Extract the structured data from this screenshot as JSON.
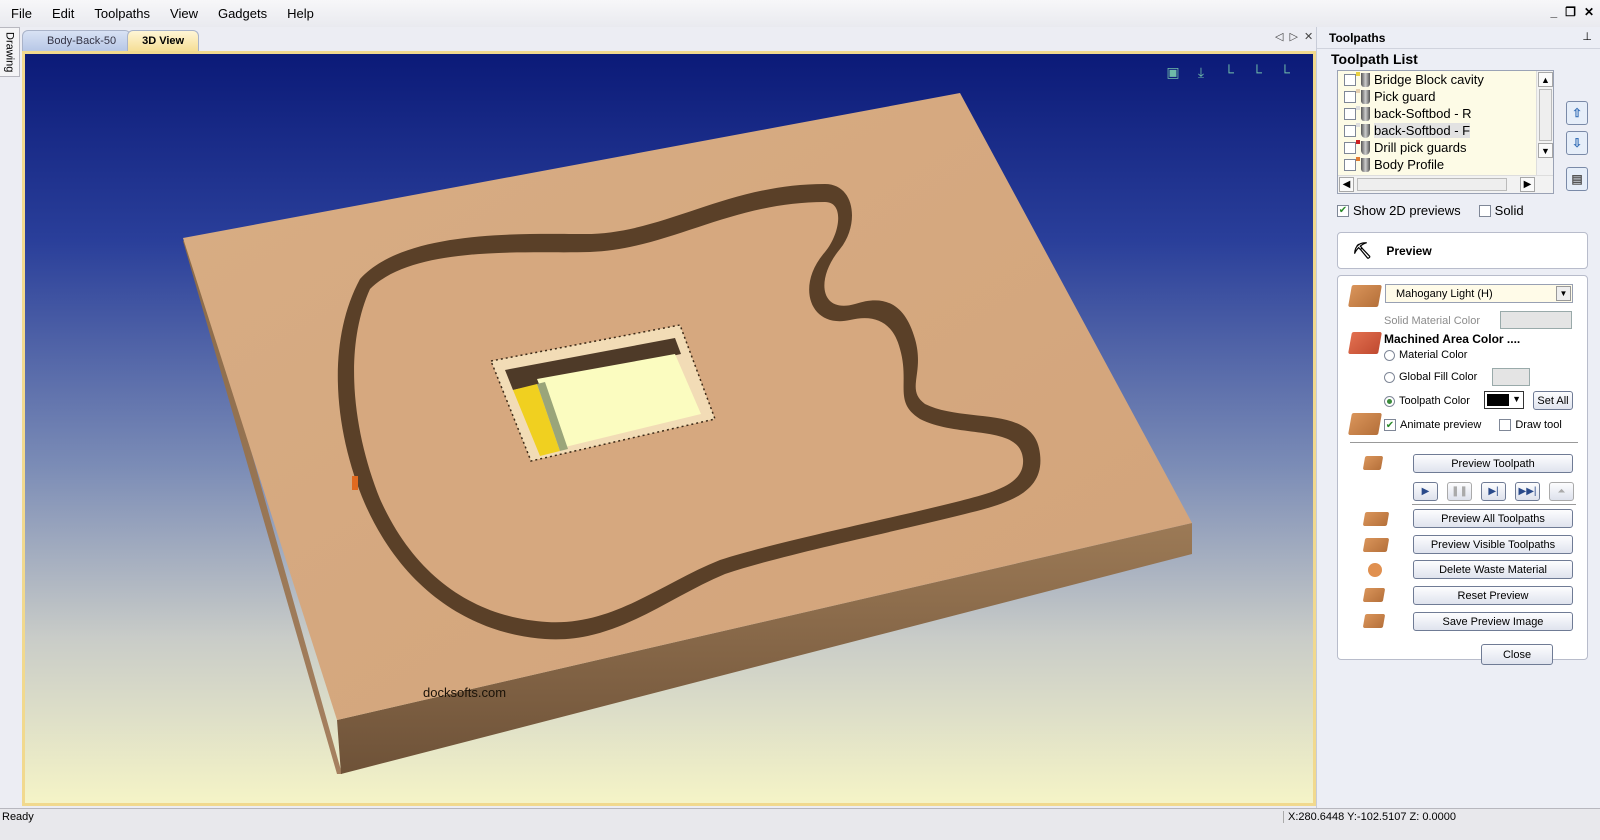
{
  "menu": [
    "File",
    "Edit",
    "Toolpaths",
    "View",
    "Gadgets",
    "Help"
  ],
  "window_controls": {
    "minimize": "_",
    "restore": "❐",
    "close": "✕"
  },
  "side_tab": "Drawing",
  "doc_tabs": [
    {
      "label": "Body-Back-50",
      "active": false
    },
    {
      "label": "3D View",
      "active": true
    }
  ],
  "doc_controls": {
    "prev": "◁",
    "next": "▷",
    "close": "✕"
  },
  "viewport": {
    "watermark": "docksofts.com",
    "view_icons": [
      "zoom-extents-icon",
      "top-view-icon",
      "iso-view-icon",
      "front-view-icon",
      "side-view-icon"
    ],
    "background_top": "#0b1a78",
    "background_bottom": "#f5f4c7",
    "wood_color": "#d9ab82"
  },
  "panel": {
    "title": "Toolpaths",
    "pin": "⊥",
    "list_title": "Toolpath List",
    "toolpaths": [
      {
        "name": "Bridge Block cavity",
        "checked": false,
        "color": "#e8d040",
        "selected": false
      },
      {
        "name": "Pick guard",
        "checked": false,
        "color": "#e6cfb0",
        "selected": false
      },
      {
        "name": "back-Softbod - R",
        "checked": false,
        "color": "#dddddd",
        "selected": false
      },
      {
        "name": "back-Softbod - F",
        "checked": false,
        "color": "#dddddd",
        "selected": true
      },
      {
        "name": "Drill pick guards",
        "checked": false,
        "color": "#cc2020",
        "selected": false
      },
      {
        "name": "Body Profile",
        "checked": false,
        "color": "#e07a30",
        "selected": false
      }
    ],
    "show_2d_previews": {
      "label": "Show 2D previews",
      "checked": true
    },
    "solid": {
      "label": "Solid",
      "checked": false
    },
    "preview_header": "Preview",
    "material": "Mahogany Light (H)",
    "solid_material_color_label": "Solid Material Color",
    "machined_area_label": "Machined Area Color ....",
    "radio_options": [
      {
        "label": "Material Color",
        "selected": false
      },
      {
        "label": "Global Fill Color",
        "selected": false
      },
      {
        "label": "Toolpath Color",
        "selected": true
      }
    ],
    "toolpath_color": "#000000",
    "set_all": "Set All",
    "animate_preview": {
      "label": "Animate preview",
      "checked": true
    },
    "draw_tool": {
      "label": "Draw tool",
      "checked": false
    },
    "preview_toolpath": "Preview Toolpath",
    "media_controls": [
      "play",
      "pause",
      "step",
      "fast-forward",
      "to-top"
    ],
    "buttons": [
      "Preview All Toolpaths",
      "Preview Visible Toolpaths",
      "Delete Waste Material",
      "Reset Preview",
      "Save Preview Image"
    ],
    "close": "Close"
  },
  "status": {
    "left": "Ready",
    "coords": "X:280.6448 Y:-102.5107 Z:  0.0000"
  }
}
